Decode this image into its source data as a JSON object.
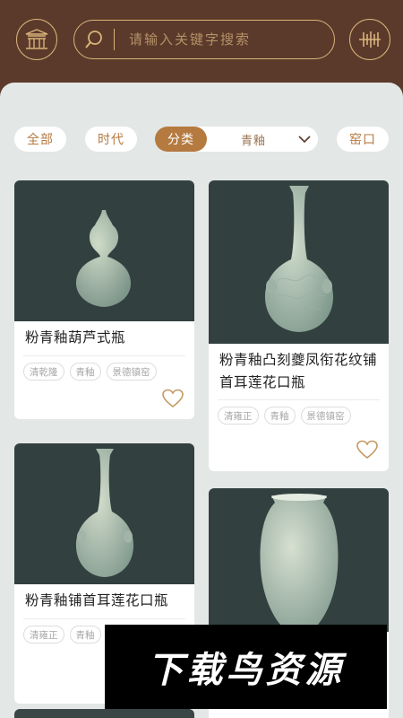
{
  "header": {
    "search_placeholder": "请输入关键字搜索"
  },
  "filters": {
    "all": "全部",
    "era": "时代",
    "category_tag": "分类",
    "category_value": "青釉",
    "kiln": "窑口"
  },
  "cards": [
    {
      "title": "粉青釉葫芦式瓶",
      "tags": [
        "清乾隆",
        "青釉",
        "景德镇窑"
      ]
    },
    {
      "title": "粉青釉凸刻夔凤衔花纹铺首耳莲花口瓶",
      "tags": [
        "清雍正",
        "青釉",
        "景德镇窑"
      ]
    },
    {
      "title": "粉青釉铺首耳莲花口瓶",
      "tags": [
        "清雍正",
        "青釉"
      ]
    },
    {
      "title": "",
      "tags": []
    }
  ],
  "watermark": "下载鸟资源",
  "colors": {
    "header_bg": "#5b3a2b",
    "accent_gold": "#d9b37a",
    "accent_brown": "#b57a3f",
    "panel_bg": "#e3e7e6",
    "image_bg": "#334040"
  },
  "icons": {
    "left_button": "palace-icon",
    "search": "search-icon",
    "right_button": "barcode-scan-icon",
    "dropdown": "chevron-down-icon",
    "favorite": "heart-icon"
  }
}
